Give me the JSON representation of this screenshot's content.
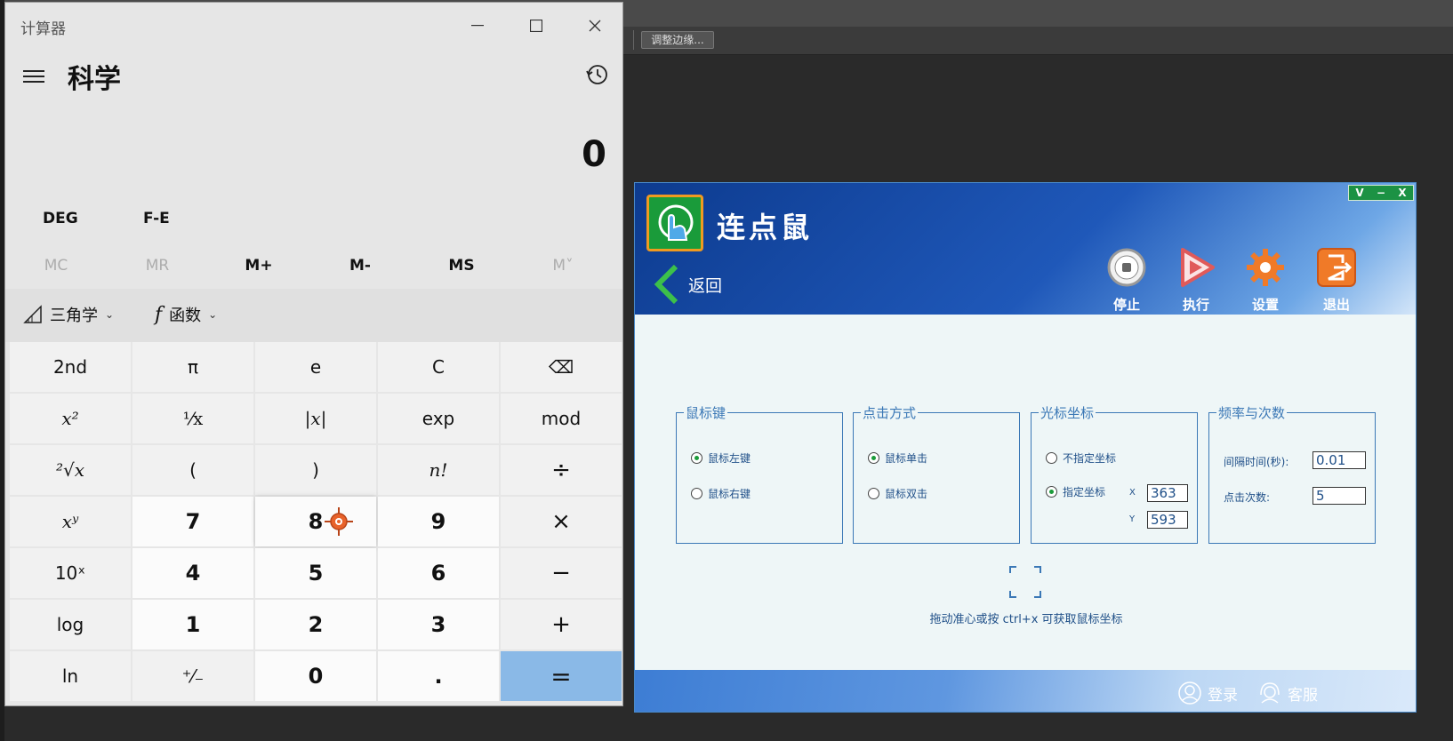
{
  "background_app": {
    "toolbar_button": "调整边缘..."
  },
  "calculator": {
    "window_title": "计算器",
    "mode": "科学",
    "display": "0",
    "angle_mode": "DEG",
    "notation": "F-E",
    "memory": [
      "MC",
      "MR",
      "M+",
      "M-",
      "MS",
      "M˅"
    ],
    "memory_disabled": [
      true,
      true,
      false,
      false,
      false,
      true
    ],
    "trig_label": "三角学",
    "func_label": "函数",
    "keys": [
      {
        "t": "2nd",
        "kind": "fn"
      },
      {
        "t": "π",
        "kind": "fn"
      },
      {
        "t": "e",
        "kind": "fn"
      },
      {
        "t": "C",
        "kind": "fn"
      },
      {
        "t": "⌫",
        "kind": "fn"
      },
      {
        "t": "x²",
        "kind": "fn"
      },
      {
        "t": "¹⁄x",
        "kind": "fn"
      },
      {
        "t": "|x|",
        "kind": "fn"
      },
      {
        "t": "exp",
        "kind": "fn"
      },
      {
        "t": "mod",
        "kind": "fn"
      },
      {
        "t": "²√x",
        "kind": "fn"
      },
      {
        "t": "(",
        "kind": "fn"
      },
      {
        "t": ")",
        "kind": "fn"
      },
      {
        "t": "n!",
        "kind": "fn"
      },
      {
        "t": "÷",
        "kind": "op"
      },
      {
        "t": "xʸ",
        "kind": "fn"
      },
      {
        "t": "7",
        "kind": "num"
      },
      {
        "t": "8",
        "kind": "num"
      },
      {
        "t": "9",
        "kind": "num"
      },
      {
        "t": "×",
        "kind": "op"
      },
      {
        "t": "10ˣ",
        "kind": "fn"
      },
      {
        "t": "4",
        "kind": "num"
      },
      {
        "t": "5",
        "kind": "num"
      },
      {
        "t": "6",
        "kind": "num"
      },
      {
        "t": "−",
        "kind": "op"
      },
      {
        "t": "log",
        "kind": "fn"
      },
      {
        "t": "1",
        "kind": "num"
      },
      {
        "t": "2",
        "kind": "num"
      },
      {
        "t": "3",
        "kind": "num"
      },
      {
        "t": "+",
        "kind": "op"
      },
      {
        "t": "ln",
        "kind": "fn"
      },
      {
        "t": "⁺⁄₋",
        "kind": "fn"
      },
      {
        "t": "0",
        "kind": "num"
      },
      {
        "t": ".",
        "kind": "num"
      },
      {
        "t": "=",
        "kind": "eq"
      }
    ]
  },
  "clicker": {
    "title": "连点鼠",
    "win_controls": [
      "V",
      "−",
      "X"
    ],
    "back_label": "返回",
    "tools": {
      "stop": "停止",
      "run": "执行",
      "settings": "设置",
      "exit": "退出"
    },
    "groups": {
      "mouse_button": {
        "legend": "鼠标键",
        "left": "鼠标左键",
        "right": "鼠标右键"
      },
      "click_mode": {
        "legend": "点击方式",
        "single": "鼠标单击",
        "double": "鼠标双击"
      },
      "cursor_coord": {
        "legend": "光标坐标",
        "none": "不指定坐标",
        "specified": "指定坐标",
        "x_label": "X",
        "y_label": "Y",
        "x_value": "363",
        "y_value": "593"
      },
      "frequency": {
        "legend": "频率与次数",
        "interval_label": "间隔时间(秒):",
        "interval_value": "0.01",
        "count_label": "点击次数:",
        "count_value": "5"
      }
    },
    "hint": "拖动准心或按 ctrl+x 可获取鼠标坐标",
    "footer": {
      "login": "登录",
      "service": "客服"
    }
  }
}
